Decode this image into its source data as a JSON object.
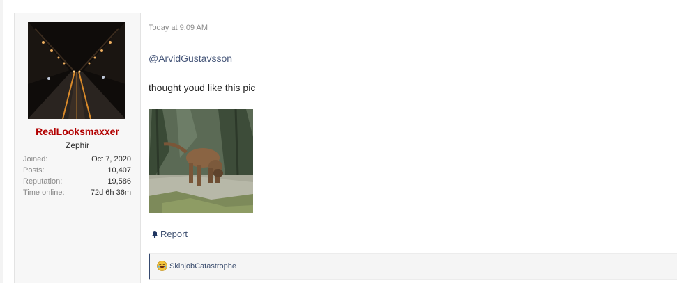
{
  "post": {
    "user": {
      "name": "RealLooksmaxxer",
      "title": "Zephir",
      "stats": [
        {
          "label": "Joined:",
          "value": "Oct 7, 2020"
        },
        {
          "label": "Posts:",
          "value": "10,407"
        },
        {
          "label": "Reputation:",
          "value": "19,586"
        },
        {
          "label": "Time online:",
          "value": "72d 6h 36m"
        }
      ]
    },
    "timestamp": "Today at 9:09 AM",
    "mention": "@ArvidGustavsson",
    "body": "thought youd like this pic",
    "report_label": "Report",
    "reactions": {
      "user": "SkinjobCatastrophe",
      "icon": "laughing-emoji-icon"
    }
  },
  "colors": {
    "username": "#b20000",
    "link": "#47577a",
    "reaction_accent": "#35496f"
  }
}
